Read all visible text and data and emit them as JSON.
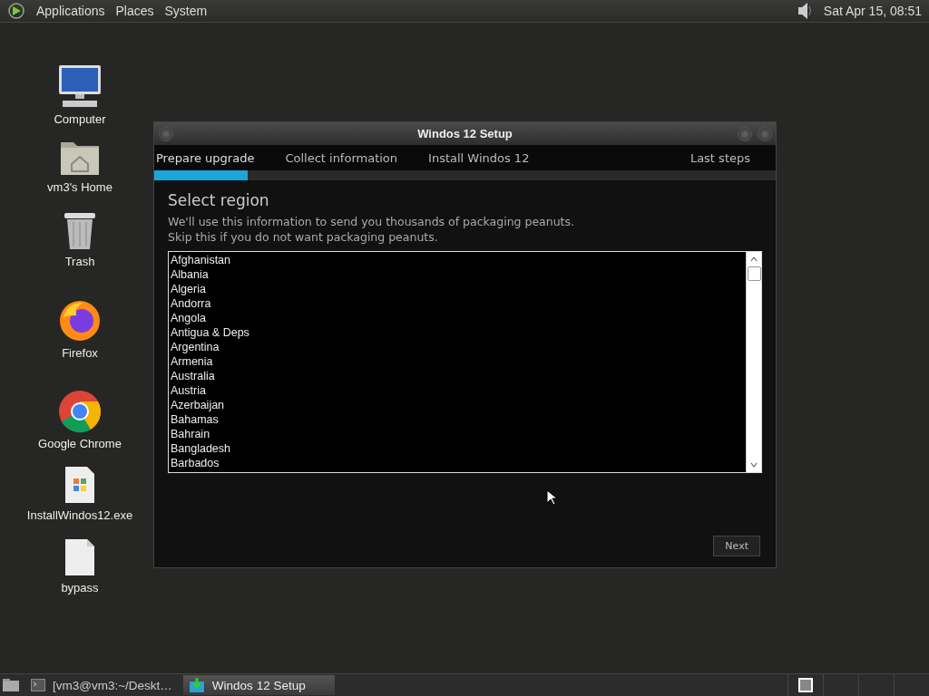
{
  "top_panel": {
    "menus": [
      "Applications",
      "Places",
      "System"
    ],
    "clock": "Sat Apr 15, 08:51"
  },
  "desktop_icons": [
    {
      "kind": "computer",
      "label": "Computer"
    },
    {
      "kind": "home",
      "label": "vm3's Home"
    },
    {
      "kind": "trash",
      "label": "Trash"
    },
    {
      "kind": "firefox",
      "label": "Firefox"
    },
    {
      "kind": "chrome",
      "label": "Google Chrome"
    },
    {
      "kind": "exe",
      "label": "InstallWindos12.exe"
    },
    {
      "kind": "file",
      "label": "bypass"
    }
  ],
  "window": {
    "title": "Windos 12 Setup",
    "steps": [
      {
        "label": "Prepare upgrade",
        "selected": true
      },
      {
        "label": "Collect information",
        "selected": false
      },
      {
        "label": "Install Windos 12",
        "selected": false
      },
      {
        "label": "Last steps",
        "selected": false
      }
    ],
    "progress": {
      "level": 0.15
    },
    "heading": "Select region",
    "description": [
      "We'll use this information to send you thousands of packaging peanuts.",
      "Skip this if you do not want packaging peanuts."
    ],
    "regions": [
      "Afghanistan",
      "Albania",
      "Algeria",
      "Andorra",
      "Angola",
      "Antigua & Deps",
      "Argentina",
      "Armenia",
      "Australia",
      "Austria",
      "Azerbaijan",
      "Bahamas",
      "Bahrain",
      "Bangladesh",
      "Barbados"
    ],
    "next_button": "Next"
  },
  "taskbar": {
    "tasks": [
      {
        "kind": "terminal",
        "label": "[vm3@vm3:~/Deskt…",
        "selected": false
      },
      {
        "kind": "installer",
        "label": "Windos 12 Setup",
        "selected": true
      }
    ],
    "workspaces": [
      {
        "selected": true
      },
      {
        "selected": false
      },
      {
        "selected": false
      },
      {
        "selected": false
      }
    ]
  }
}
